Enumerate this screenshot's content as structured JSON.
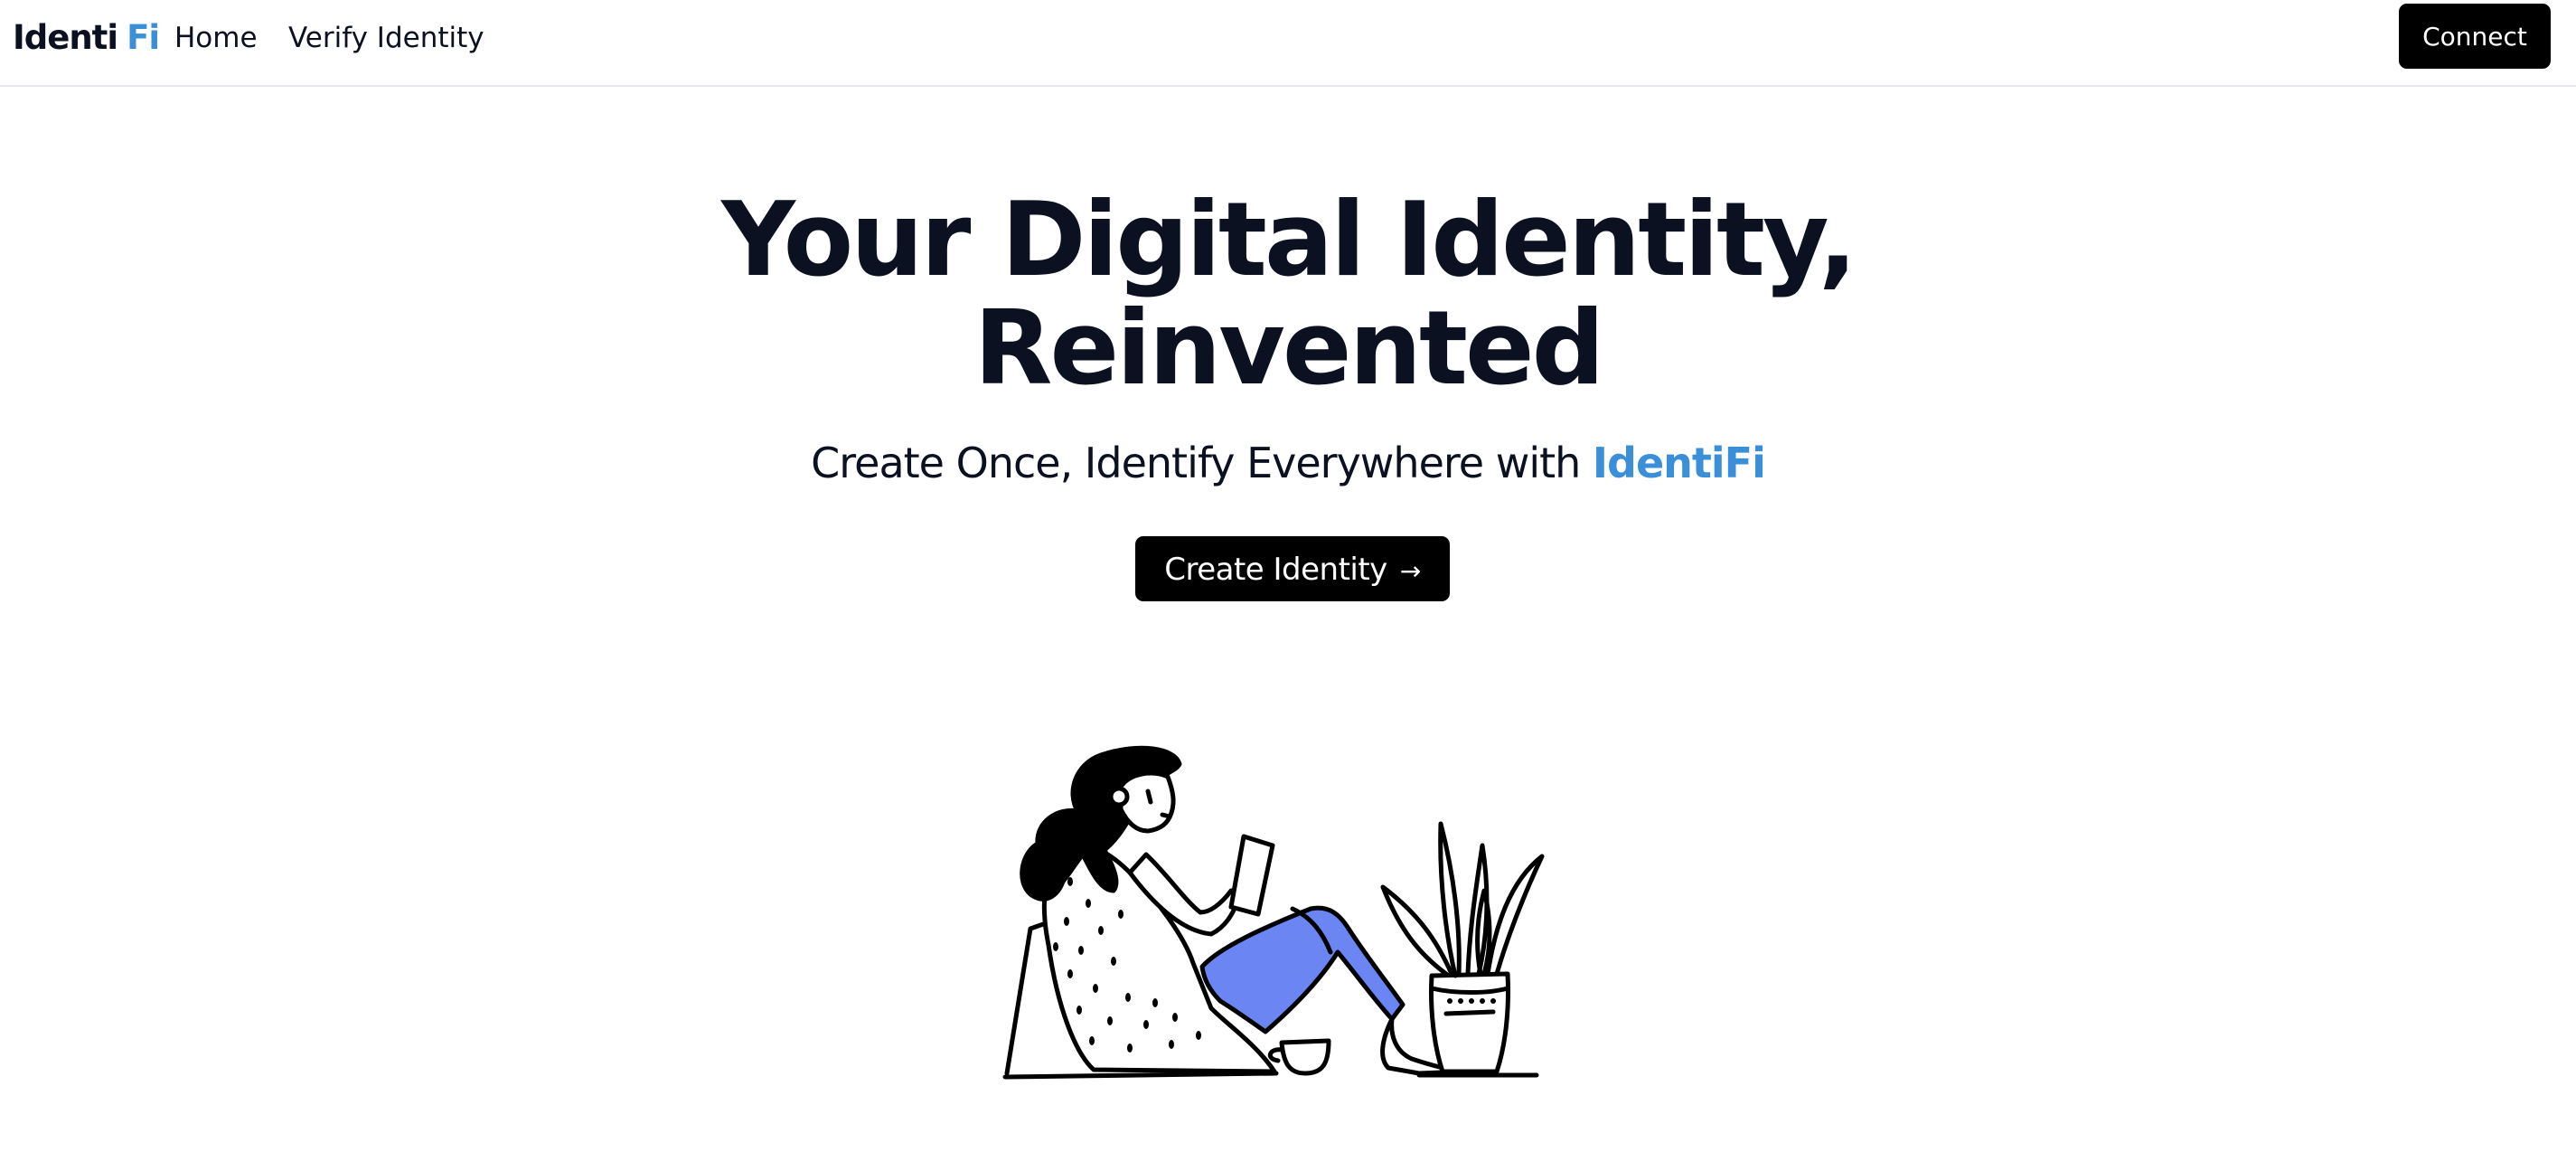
{
  "header": {
    "logo_main": "Identi",
    "logo_accent": "Fi",
    "nav": [
      {
        "label": "Home"
      },
      {
        "label": "Verify Identity"
      }
    ],
    "connect_label": "Connect"
  },
  "hero": {
    "title_line1": "Your Digital Identity,",
    "title_line2": "Reinvented",
    "subtitle_prefix": "Create Once, Identify Everywhere with",
    "subtitle_brand": "IdentiFi",
    "cta_label": "Create Identity",
    "cta_icon": "arrow-right-icon"
  },
  "illustration": {
    "icon": "woman-reading-phone-with-plant-illustration"
  },
  "colors": {
    "accent": "#3a8fd8",
    "text": "#0b1120",
    "button_bg": "#000000",
    "pants": "#6b86f2"
  }
}
